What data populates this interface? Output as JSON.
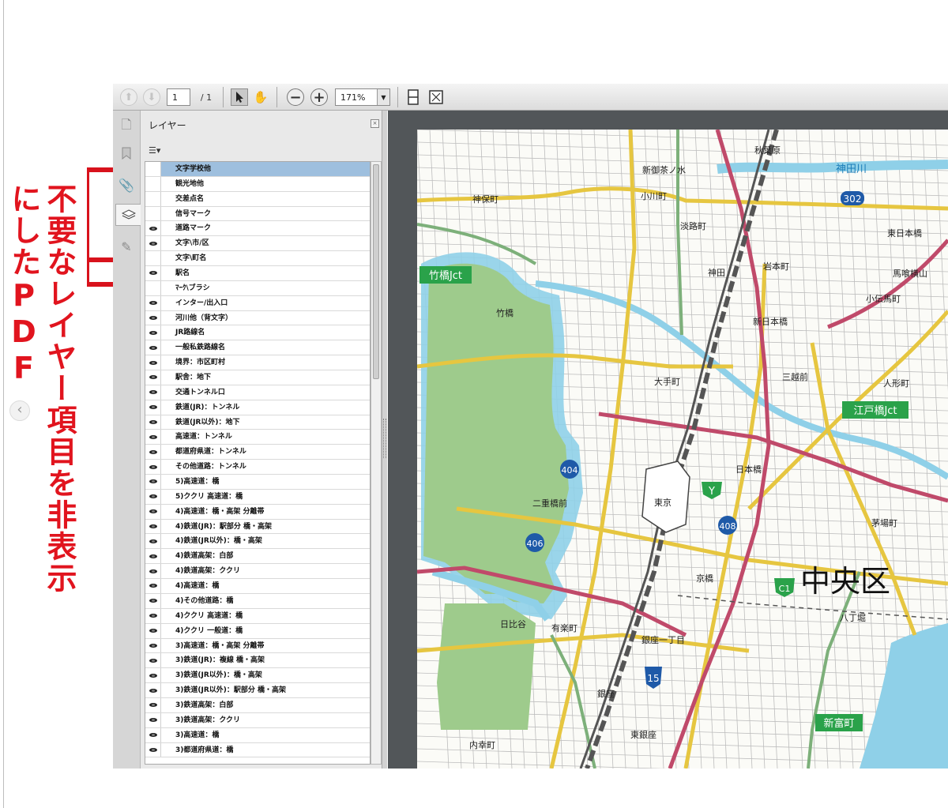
{
  "annotation": {
    "column1": "不要なレイヤー項目を非表示",
    "column2": "にしたPDF"
  },
  "nav": {
    "prev_arrow": "‹",
    "next_arrow": "›"
  },
  "toolbar": {
    "page_current": "1",
    "page_total": "/ 1",
    "zoom_value": "171%",
    "zoom_out_glyph": "−",
    "zoom_in_glyph": "+"
  },
  "panel": {
    "title": "レイヤー",
    "close_glyph": "×",
    "options_glyph": "☰▾"
  },
  "layers": [
    {
      "name": "文字学校他",
      "visible": false,
      "selected": true
    },
    {
      "name": "観光地他",
      "visible": false
    },
    {
      "name": "交差点名",
      "visible": false
    },
    {
      "name": "信号マーク",
      "visible": false
    },
    {
      "name": "道路マーク",
      "visible": true
    },
    {
      "name": "文字\\市/区",
      "visible": true
    },
    {
      "name": "文字\\町名",
      "visible": false
    },
    {
      "name": "駅名",
      "visible": true
    },
    {
      "name": "ﾏｰｸ\\ブラシ",
      "visible": false
    },
    {
      "name": "インター/出入口",
      "visible": true
    },
    {
      "name": "河川他（背文字）",
      "visible": true
    },
    {
      "name": "JR路線名",
      "visible": true
    },
    {
      "name": "一般私鉄路線名",
      "visible": true
    },
    {
      "name": "境界：市区町村",
      "visible": true
    },
    {
      "name": "駅舎：地下",
      "visible": true
    },
    {
      "name": "交通トンネル口",
      "visible": true
    },
    {
      "name": "鉄道(JR)：トンネル",
      "visible": true
    },
    {
      "name": "鉄道(JR以外)：地下",
      "visible": true
    },
    {
      "name": "高速道：トンネル",
      "visible": true
    },
    {
      "name": "都道府県道：トンネル",
      "visible": true
    },
    {
      "name": "その他道路：トンネル",
      "visible": true
    },
    {
      "name": "5)高速道：橋",
      "visible": true
    },
    {
      "name": "5)ククリ 高速道：橋",
      "visible": true
    },
    {
      "name": "4)高速道：橋・高架 分離帯",
      "visible": true
    },
    {
      "name": "4)鉄道(JR)：駅部分 橋・高架",
      "visible": true
    },
    {
      "name": "4)鉄道(JR以外)：橋・高架",
      "visible": true
    },
    {
      "name": "4)鉄道高架：白部",
      "visible": true
    },
    {
      "name": "4)鉄道高架：ククリ",
      "visible": true
    },
    {
      "name": "4)高速道：橋",
      "visible": true
    },
    {
      "name": "4)その他道路：橋",
      "visible": true
    },
    {
      "name": "4)ククリ 高速道：橋",
      "visible": true
    },
    {
      "name": "4)ククリ 一般道：橋",
      "visible": true
    },
    {
      "name": "3)高速道：橋・高架 分離帯",
      "visible": true
    },
    {
      "name": "3)鉄道(JR)：複線 橋・高架",
      "visible": true
    },
    {
      "name": "3)鉄道(JR以外)：橋・高架",
      "visible": true
    },
    {
      "name": "3)鉄道(JR以外)：駅部分 橋・高架",
      "visible": true
    },
    {
      "name": "3)鉄道高架：白部",
      "visible": true
    },
    {
      "name": "3)鉄道高架：ククリ",
      "visible": true
    },
    {
      "name": "3)高速道：橋",
      "visible": true
    },
    {
      "name": "3)都道府県道：橋",
      "visible": true
    }
  ],
  "map": {
    "colors": {
      "water": "#8fd0e8",
      "park": "#9ecb8c",
      "expressway": "#c04a6a",
      "main_road": "#e6c640",
      "green_road": "#7db07a",
      "rail": "#555555"
    },
    "labels": {
      "jct1": "竹橋Jct",
      "jct2": "江戸橋Jct",
      "ramp": "新富町",
      "route302": "302",
      "route404": "404",
      "route406": "406",
      "route408": "408",
      "routeY": "Y",
      "routeC1": "C1",
      "route15": "15",
      "ward": "中央区",
      "river": "神田川",
      "st_tokyo": "東京",
      "st_otemachi": "大手町",
      "st_nihonbashi": "日本橋",
      "st_kanda": "神田",
      "st_akihabara": "秋葉原",
      "st_ginza": "銀座",
      "st_yurakucho": "有楽町",
      "st_kyobashi": "京橋",
      "st_hibiya": "日比谷",
      "st_ochanomizu": "新御茶ノ水",
      "st_ogawamachi": "小川町",
      "st_awajicho": "淡路町",
      "st_jimbocho": "神保町",
      "st_takebashi": "竹橋",
      "st_nijubashi": "二重橋前",
      "st_mitsukoshi": "三越前",
      "st_ningyocho": "人形町",
      "st_kayabacho": "茅場町",
      "st_higashiginza": "東銀座",
      "st_uchisaiwaicho": "内幸町",
      "st_hatchobori": "八丁堀",
      "st_ginza1": "銀座一丁目",
      "st_kodemmacho": "小伝馬町",
      "st_bakuro": "馬喰横山",
      "st_shinnihonbashi": "新日本橋",
      "st_iwamotocho": "岩本町",
      "st_higashinihonbashi": "東日本橋"
    }
  }
}
